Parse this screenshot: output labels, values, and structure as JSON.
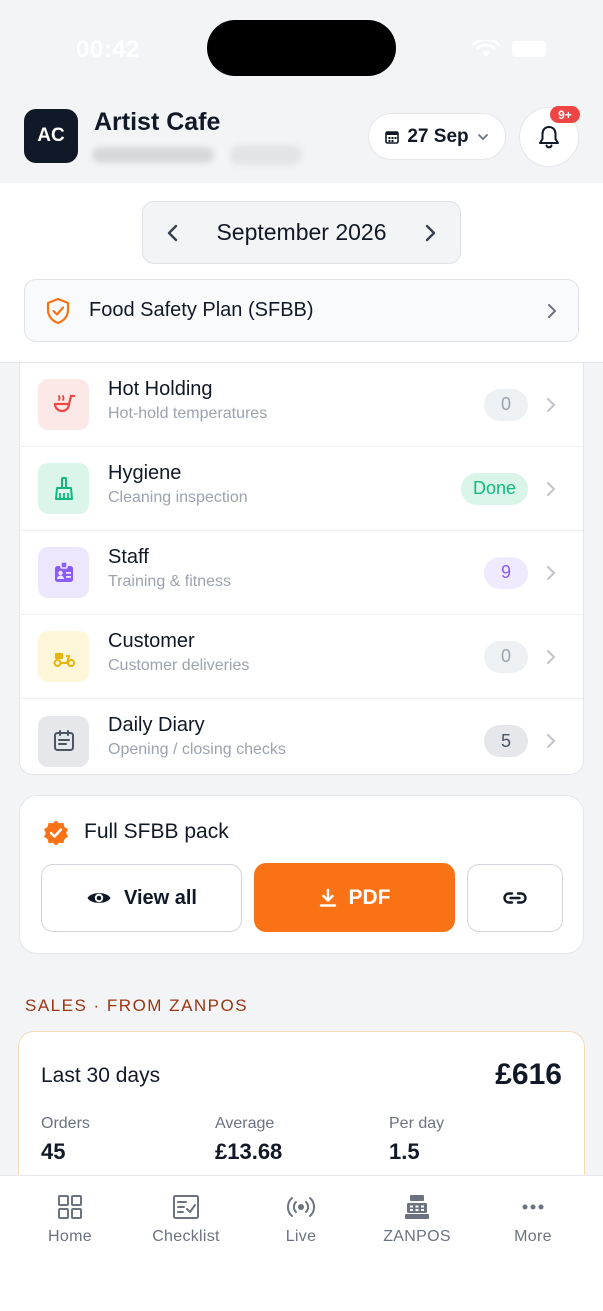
{
  "status_bar": {
    "time": "00:42"
  },
  "header": {
    "avatar_initials": "AC",
    "venue_name": "Artist Cafe",
    "date_label": "27 Sep",
    "notification_badge": "9+"
  },
  "month_nav": {
    "label": "September 2026"
  },
  "sfbb_bar": {
    "label": "Food Safety Plan (SFBB)"
  },
  "checklist": [
    {
      "title": "Hot Holding",
      "subtitle": "Hot-hold temperatures",
      "badge": "0"
    },
    {
      "title": "Hygiene",
      "subtitle": "Cleaning inspection",
      "badge": "Done"
    },
    {
      "title": "Staff",
      "subtitle": "Training & fitness",
      "badge": "9"
    },
    {
      "title": "Customer",
      "subtitle": "Customer deliveries",
      "badge": "0"
    },
    {
      "title": "Daily Diary",
      "subtitle": "Opening / closing checks",
      "badge": "5"
    }
  ],
  "pack": {
    "title": "Full SFBB pack",
    "view_all_label": "View all",
    "pdf_label": "PDF"
  },
  "sales": {
    "section_label": "SALES · FROM ZANPOS",
    "period": "Last 30 days",
    "total": "£616",
    "stats": [
      {
        "label": "Orders",
        "value": "45"
      },
      {
        "label": "Average",
        "value": "£13.68"
      },
      {
        "label": "Per day",
        "value": "1.5"
      }
    ]
  },
  "tabbar": [
    {
      "label": "Home",
      "icon": "grid-icon"
    },
    {
      "label": "Checklist",
      "icon": "checklist-icon"
    },
    {
      "label": "Live",
      "icon": "broadcast-icon"
    },
    {
      "label": "ZANPOS",
      "icon": "register-icon"
    },
    {
      "label": "More",
      "icon": "more-icon"
    }
  ],
  "colors": {
    "accent_orange": "#f97316",
    "done_green": "#10b981",
    "staff_purple": "#8b5cf6",
    "notification_red": "#ef4444"
  }
}
